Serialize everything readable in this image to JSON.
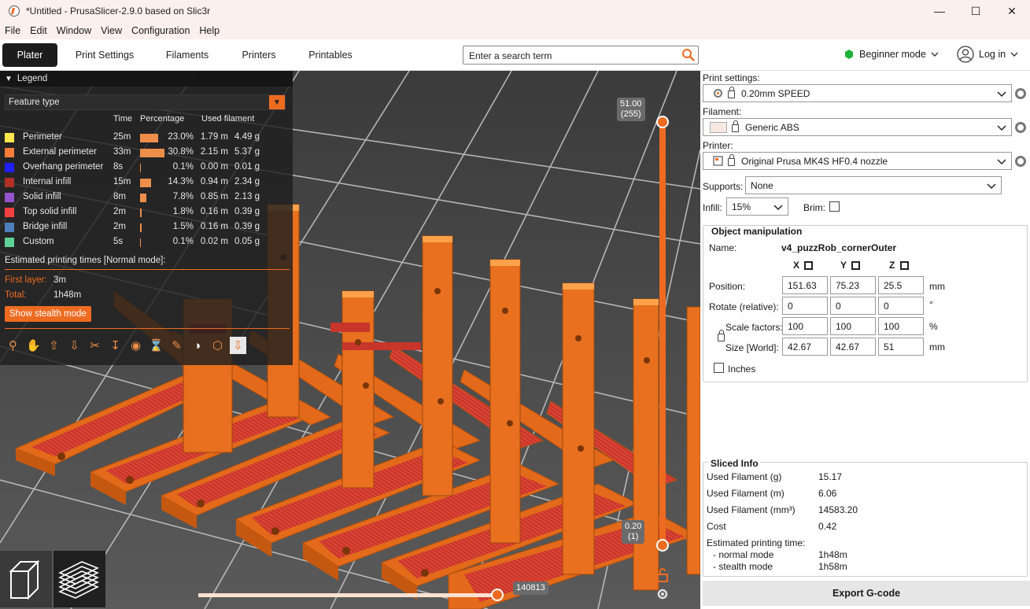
{
  "window": {
    "title": "*Untitled - PrusaSlicer-2.9.0 based on Slic3r"
  },
  "menu": [
    "File",
    "Edit",
    "Window",
    "View",
    "Configuration",
    "Help"
  ],
  "tabs": [
    "Plater",
    "Print Settings",
    "Filaments",
    "Printers",
    "Printables"
  ],
  "search": {
    "placeholder": "Enter a search term"
  },
  "mode": {
    "label": "Beginner mode",
    "color": "#00b000"
  },
  "login": {
    "label": "Log in"
  },
  "legend": {
    "title": "Legend",
    "view_type": "Feature type",
    "headers": {
      "time": "Time",
      "percentage": "Percentage",
      "used": "Used filament"
    },
    "rows": [
      {
        "name": "Perimeter",
        "color": "#ffe64d",
        "time": "25m",
        "pct": "23.0%",
        "pct_value": 23.0,
        "m": "1.79 m",
        "g": "4.49 g"
      },
      {
        "name": "External perimeter",
        "color": "#ff7d38",
        "time": "33m",
        "pct": "30.8%",
        "pct_value": 30.8,
        "m": "2.15 m",
        "g": "5.37 g"
      },
      {
        "name": "Overhang perimeter",
        "color": "#1f1fff",
        "time": "8s",
        "pct": "0.1%",
        "pct_value": 0.1,
        "m": "0.00 m",
        "g": "0.01 g"
      },
      {
        "name": "Internal infill",
        "color": "#b03029",
        "time": "15m",
        "pct": "14.3%",
        "pct_value": 14.3,
        "m": "0.94 m",
        "g": "2.34 g"
      },
      {
        "name": "Solid infill",
        "color": "#9654cc",
        "time": "8m",
        "pct": "7.8%",
        "pct_value": 7.8,
        "m": "0.85 m",
        "g": "2.13 g"
      },
      {
        "name": "Top solid infill",
        "color": "#f04040",
        "time": "2m",
        "pct": "1.8%",
        "pct_value": 1.8,
        "m": "0.16 m",
        "g": "0.39 g"
      },
      {
        "name": "Bridge infill",
        "color": "#4d80ba",
        "time": "2m",
        "pct": "1.5%",
        "pct_value": 1.5,
        "m": "0.16 m",
        "g": "0.39 g"
      },
      {
        "name": "Custom",
        "color": "#5ed194",
        "time": "5s",
        "pct": "0.1%",
        "pct_value": 0.1,
        "m": "0.02 m",
        "g": "0.05 g"
      }
    ],
    "estimate_title": "Estimated printing times [Normal mode]:",
    "first_layer_label": "First layer:",
    "first_layer_value": "3m",
    "total_label": "Total:",
    "total_value": "1h48m",
    "stealth_button": "Show stealth mode",
    "tool_icons": [
      "travel-icon",
      "wipe-icon",
      "retractions-icon",
      "deretractions-icon",
      "seams-icon",
      "tool-changes-icon",
      "color-changes-icon",
      "pause-icon",
      "custom-gcode-icon",
      "center-of-gravity-icon",
      "shells-icon",
      "tool-marker-icon"
    ]
  },
  "vertical_slider": {
    "top_value": "51.00",
    "top_layer": "(255)",
    "bottom_value": "0.20",
    "bottom_layer": "(1)"
  },
  "horizontal_slider": {
    "value": "140813"
  },
  "panel": {
    "print_settings_label": "Print settings:",
    "print_settings_value": "0.20mm SPEED",
    "filament_label": "Filament:",
    "filament_value": "Generic ABS",
    "filament_color": "#f7e8e2",
    "printer_label": "Printer:",
    "printer_value": "Original Prusa MK4S HF0.4 nozzle",
    "supports_label": "Supports:",
    "supports_value": "None",
    "infill_label": "Infill:",
    "infill_value": "15%",
    "brim_label": "Brim:",
    "object_manipulation": {
      "title": "Object manipulation",
      "name_label": "Name:",
      "name_value": "v4_puzzRob_cornerOuter",
      "axes": [
        "X",
        "Y",
        "Z"
      ],
      "position_label": "Position:",
      "position": [
        "151.63",
        "75.23",
        "25.5"
      ],
      "position_unit": "mm",
      "rotate_label": "Rotate (relative):",
      "rotate": [
        "0",
        "0",
        "0"
      ],
      "rotate_unit": "°",
      "scale_label": "Scale factors:",
      "scale": [
        "100",
        "100",
        "100"
      ],
      "scale_unit": "%",
      "size_label": "Size [World]:",
      "size": [
        "42.67",
        "42.67",
        "51"
      ],
      "size_unit": "mm",
      "inches_label": "Inches"
    },
    "sliced_info": {
      "title": "Sliced Info",
      "rows": [
        {
          "label": "Used Filament (g)",
          "value": "15.17"
        },
        {
          "label": "Used Filament (m)",
          "value": "6.06"
        },
        {
          "label": "Used Filament (mm³)",
          "value": "14583.20"
        },
        {
          "label": "Cost",
          "value": "0.42"
        }
      ],
      "est_label": "Estimated printing time:",
      "normal_label": "- normal mode",
      "normal_value": "1h48m",
      "stealth_label": "- stealth mode",
      "stealth_value": "1h58m"
    },
    "export_button": "Export G-code"
  }
}
